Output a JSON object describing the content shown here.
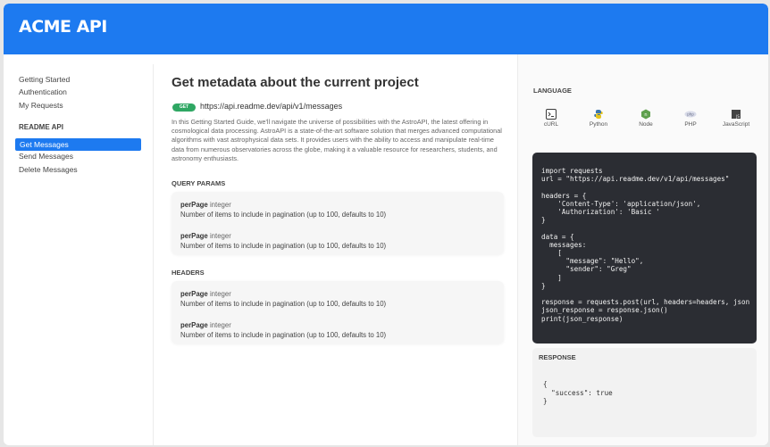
{
  "app": {
    "logo": "ACME API"
  },
  "sidebar": {
    "items": [
      {
        "label": "Getting Started"
      },
      {
        "label": "Authentication"
      },
      {
        "label": "My Requests"
      }
    ],
    "section_title": "README API",
    "api_items": [
      {
        "label": "Get Messages",
        "active": true
      },
      {
        "label": "Send Messages"
      },
      {
        "label": "Delete Messages"
      }
    ]
  },
  "main": {
    "title": "Get metadata about the current project",
    "method": "GET",
    "url": "https://api.readme.dev/api/v1/messages",
    "intro": "In this Getting Started Guide, we'll navigate the universe of possibilities with the AstroAPI, the latest offering in cosmological data processing. AstroAPI is a state-of-the-art software solution that merges advanced computational algorithms with vast astrophysical data sets. It provides users with the ability to access and manipulate real-time data from numerous observatories across the globe, making it a valuable resource for researchers, students, and astronomy enthusiasts.",
    "query_params_label": "QUERY PARAMS",
    "query_params": [
      {
        "name": "perPage",
        "type": "integer",
        "desc": "Number of items to include in pagination (up to 100, defaults to 10)"
      },
      {
        "name": "perPage",
        "type": "integer",
        "desc": "Number of items to include in pagination (up to 100, defaults to 10)"
      }
    ],
    "headers_label": "HEADERS",
    "headers": [
      {
        "name": "perPage",
        "type": "integer",
        "desc": "Number of items to include in pagination (up to 100, defaults to 10)"
      },
      {
        "name": "perPage",
        "type": "integer",
        "desc": "Number of items to include in pagination (up to 100, defaults to 10)"
      }
    ]
  },
  "right": {
    "language_label": "LANGUAGE",
    "languages": [
      {
        "name": "cURL",
        "icon": "terminal-icon",
        "color": "#3a3a3a"
      },
      {
        "name": "Python",
        "icon": "python-icon",
        "color": "#e8c61c"
      },
      {
        "name": "Node",
        "icon": "node-icon",
        "color": "#5fa04e"
      },
      {
        "name": "PHP",
        "icon": "php-icon",
        "color": "#8892bf"
      },
      {
        "name": "JavaScript",
        "icon": "javascript-icon",
        "color": "#444444"
      }
    ],
    "code": "import requests\nurl = \"https://api.readme.dev/v1/api/messages\"\n\nheaders = {\n    'Content-Type': 'application/json',\n    'Authorization': 'Basic '\n}\n\ndata = {\n  messages:\n    [\n      \"message\": \"Hello\",\n      \"sender\": \"Greg\"\n    ]\n}\n\nresponse = requests.post(url, headers=headers, json\njson_response = response.json()\nprint(json_response)",
    "response_label": "RESPONSE",
    "response": "{\n  \"success\": true\n}"
  }
}
